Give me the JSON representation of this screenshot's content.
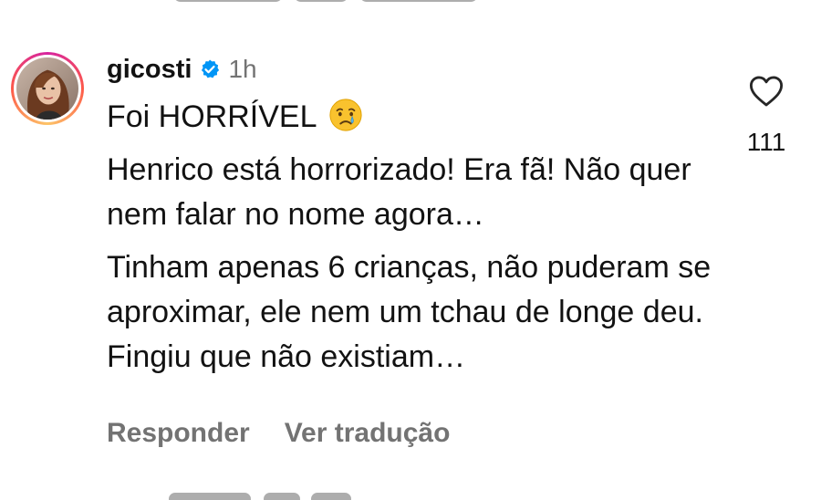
{
  "comment": {
    "username": "gicosti",
    "verified": true,
    "time": "1h",
    "line1": "Foi HORRÍVEL",
    "emoji": "crying-face-emoji",
    "paragraph2": "Henrico está horrorizado! Era fã! Não quer nem falar no nome agora…",
    "paragraph3": "Tinham apenas 6 crianças, não puderam se aproximar, ele nem um tchau de longe deu. Fingiu que não existiam…",
    "like_count": "111"
  },
  "actions": {
    "reply_label": "Responder",
    "translate_label": "Ver tradução"
  },
  "colors": {
    "verified_blue": "#0095f6",
    "secondary_text": "#737373",
    "primary_text": "#121212"
  }
}
